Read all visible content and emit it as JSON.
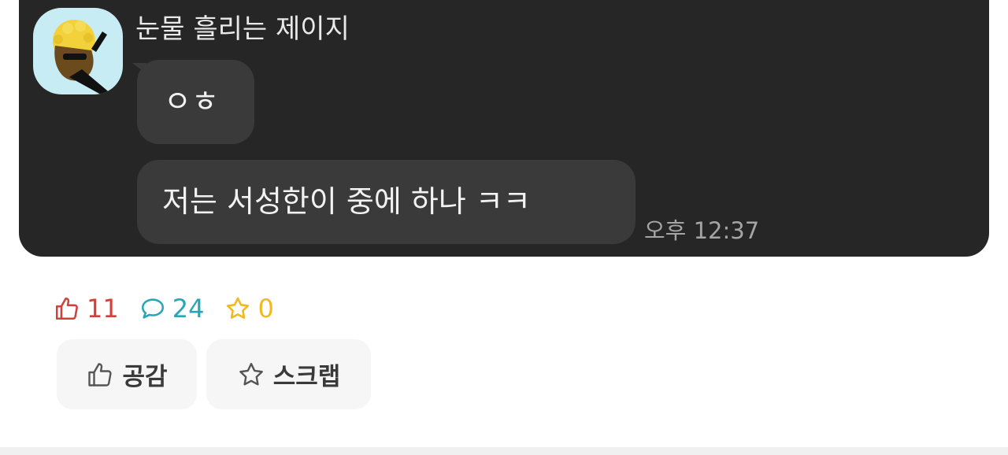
{
  "chat": {
    "sender_name": "눈물 흘리는 제이지",
    "messages": [
      {
        "text": "ㅇㅎ"
      },
      {
        "text": "저는 서성한이 중에 하나 ㅋㅋ"
      }
    ],
    "timestamp": "오후 12:37"
  },
  "stats": {
    "likes": "11",
    "comments": "24",
    "scraps": "0",
    "like_icon": "thumbs-up-icon",
    "comment_icon": "speech-bubble-icon",
    "scrap_icon": "star-icon"
  },
  "actions": {
    "like_label": "공감",
    "scrap_label": "스크랩"
  },
  "colors": {
    "card_bg": "#262626",
    "bubble_bg": "#3a3a3a",
    "like": "#d0413c",
    "comment": "#29a5b8",
    "scrap": "#f1b91e"
  }
}
